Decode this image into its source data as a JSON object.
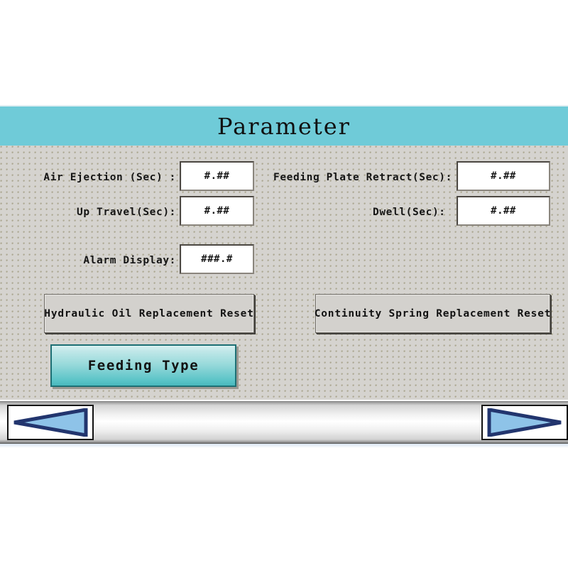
{
  "screen": {
    "title": "Parameter",
    "background_color": "#d5d3cf",
    "title_bar_color": "#6fcbd8"
  },
  "fields": [
    {
      "id": "air-ejection",
      "label": "Air Ejection (Sec) :",
      "value": "#.##"
    },
    {
      "id": "up-travel",
      "label": "Up Travel(Sec):",
      "value": "#.##"
    },
    {
      "id": "alarm-display",
      "label": "Alarm Display:",
      "value": "###.#"
    },
    {
      "id": "feeding-plate-retract",
      "label": "Feeding Plate Retract(Sec):",
      "value": "#.##"
    },
    {
      "id": "dwell",
      "label": "Dwell(Sec):",
      "value": "#.##"
    }
  ],
  "buttons": {
    "hydraulic_oil_reset": "Hydraulic Oil Replacement Reset",
    "continuity_spring_reset": "Continuity Spring Replacement Reset",
    "feeding_type": "Feeding Type"
  },
  "navigation": {
    "prev_icon": "left-triangle-arrow-icon",
    "next_icon": "right-triangle-arrow-icon",
    "arrow_fill_color": "#8ec3e8",
    "arrow_outline_color": "#22356e"
  }
}
